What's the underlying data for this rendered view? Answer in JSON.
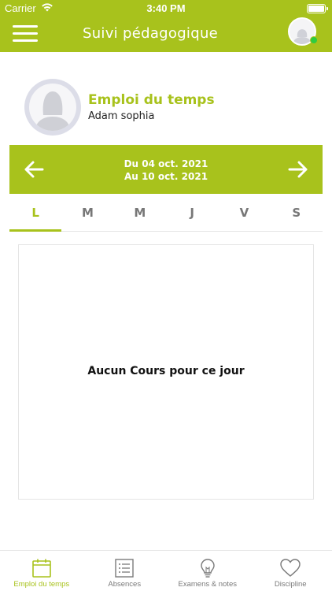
{
  "status_bar": {
    "carrier": "Carrier",
    "time": "3:40 PM"
  },
  "header": {
    "title": "Suivi pédagogique",
    "menu_icon": "hamburger-menu-icon",
    "avatar_icon": "user-avatar-icon",
    "online": true
  },
  "profile": {
    "title": "Emploi du temps",
    "name": "Adam sophia"
  },
  "week": {
    "from": "Du 04 oct. 2021",
    "to": "Au 10 oct. 2021"
  },
  "days": [
    {
      "label": "L",
      "active": true
    },
    {
      "label": "M",
      "active": false
    },
    {
      "label": "M",
      "active": false
    },
    {
      "label": "J",
      "active": false
    },
    {
      "label": "V",
      "active": false
    },
    {
      "label": "S",
      "active": false
    }
  ],
  "content": {
    "empty_message": "Aucun Cours pour ce jour"
  },
  "bottom_nav": [
    {
      "label": "Emploi du temps",
      "icon": "calendar-icon",
      "active": true
    },
    {
      "label": "Absences",
      "icon": "list-icon",
      "active": false
    },
    {
      "label": "Examens & notes",
      "icon": "lightbulb-icon",
      "active": false
    },
    {
      "label": "Discipline",
      "icon": "heart-icon",
      "active": false
    }
  ],
  "colors": {
    "accent": "#a8c21c",
    "online": "#2ecc40",
    "inactive": "#7a7a7a"
  }
}
